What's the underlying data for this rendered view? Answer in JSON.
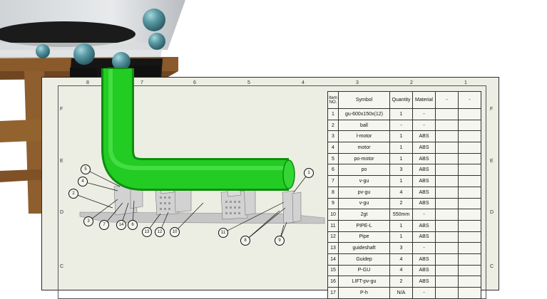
{
  "drawing": {
    "zones_top": [
      "8",
      "7",
      "6",
      "5",
      "4",
      "3",
      "2",
      "1"
    ],
    "zones_side": [
      "F",
      "E",
      "D",
      "C"
    ],
    "balloons": [
      "1",
      "2",
      "3",
      "4",
      "5",
      "6",
      "7",
      "8",
      "9",
      "10",
      "11",
      "12",
      "13",
      "14"
    ]
  },
  "bom": {
    "headers": [
      "Item NO.",
      "Symbol",
      "Quantity",
      "Material",
      "-",
      "-"
    ],
    "rows": [
      {
        "item": "1",
        "symbol": "gu-600x150x(12)",
        "qty": "1",
        "material": "-"
      },
      {
        "item": "2",
        "symbol": "ball",
        "qty": "-",
        "material": "-"
      },
      {
        "item": "3",
        "symbol": "l-motor",
        "qty": "1",
        "material": "ABS"
      },
      {
        "item": "4",
        "symbol": "motor",
        "qty": "1",
        "material": "ABS"
      },
      {
        "item": "5",
        "symbol": "po-motor",
        "qty": "1",
        "material": "ABS"
      },
      {
        "item": "6",
        "symbol": "po",
        "qty": "3",
        "material": "ABS"
      },
      {
        "item": "7",
        "symbol": "v-gu",
        "qty": "1",
        "material": "ABS"
      },
      {
        "item": "8",
        "symbol": "pv-gu",
        "qty": "4",
        "material": "ABS"
      },
      {
        "item": "9",
        "symbol": "v-gu",
        "qty": "2",
        "material": "ABS"
      },
      {
        "item": "10",
        "symbol": "2gt",
        "qty": "550mm",
        "material": "-"
      },
      {
        "item": "11",
        "symbol": "PIPE-L",
        "qty": "1",
        "material": "ABS"
      },
      {
        "item": "12",
        "symbol": "Pipe",
        "qty": "1",
        "material": "ABS"
      },
      {
        "item": "13",
        "symbol": "guideshaft",
        "qty": "3",
        "material": "-"
      },
      {
        "item": "14",
        "symbol": "Guidep",
        "qty": "4",
        "material": "ABS"
      },
      {
        "item": "15",
        "symbol": "P-GU",
        "qty": "4",
        "material": "ABS"
      },
      {
        "item": "16",
        "symbol": "LIFT-pv-gu",
        "qty": "2",
        "material": "ABS"
      },
      {
        "item": "17",
        "symbol": "P-h",
        "qty": "N/A",
        "material": "-"
      }
    ]
  },
  "colors": {
    "pipe_green": "#1fc41f",
    "sheet_bg": "#eceee4",
    "ball_teal": "#4e8f9a",
    "wood": "#8a5a2b",
    "part_grey": "#c8c8c8"
  }
}
